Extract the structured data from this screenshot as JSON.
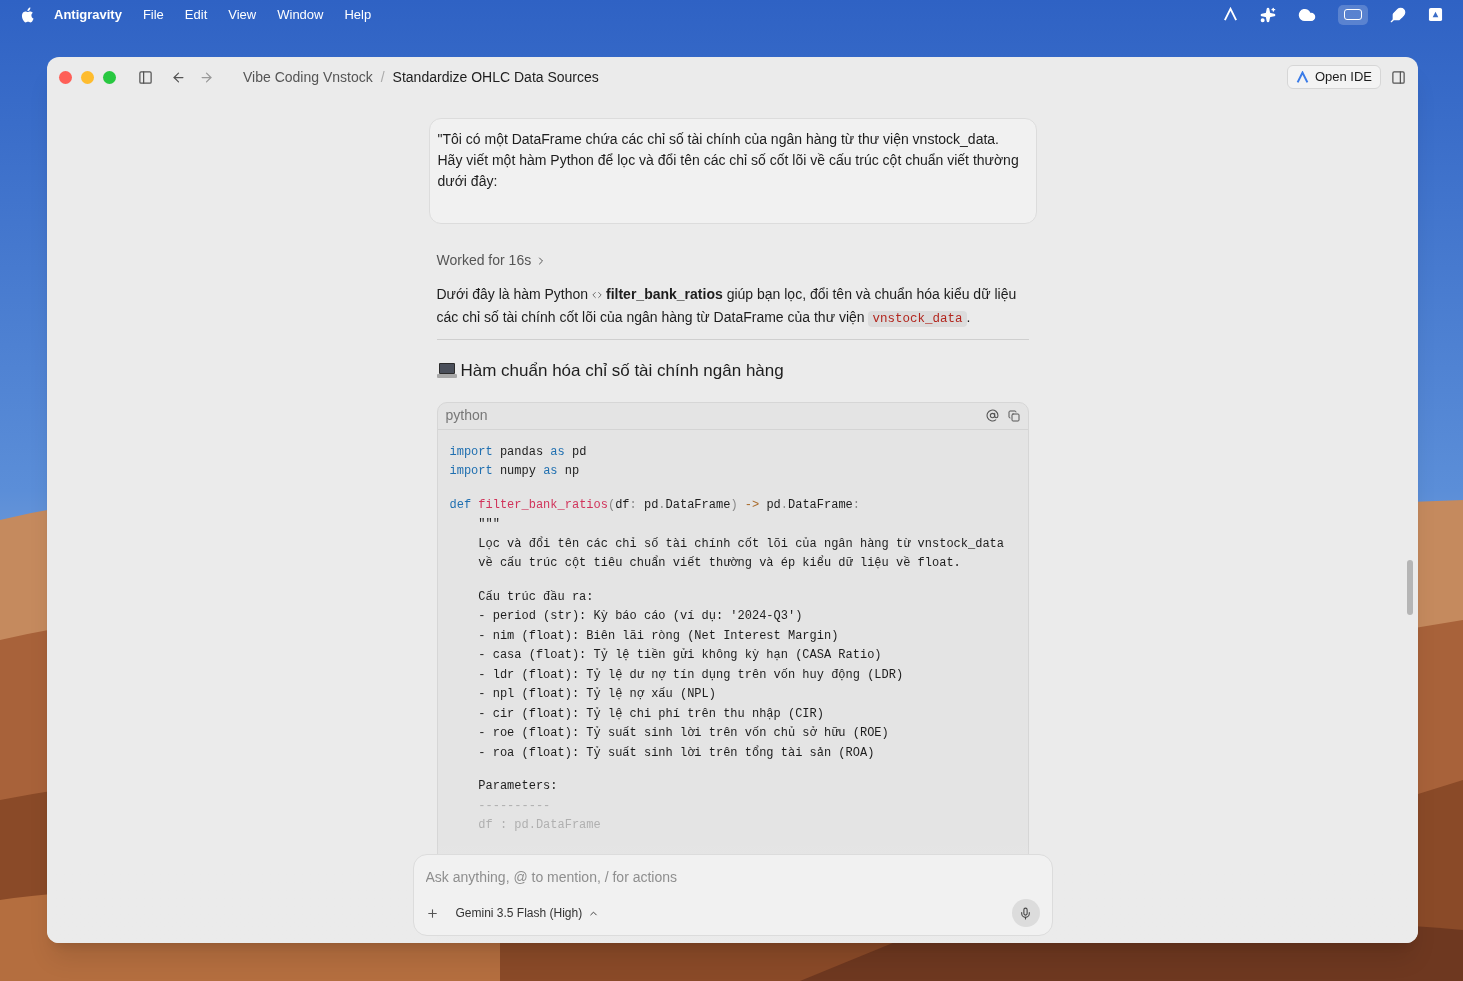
{
  "menu_bar": {
    "app_name": "Antigravity",
    "menus": [
      "File",
      "Edit",
      "View",
      "Window",
      "Help"
    ]
  },
  "window": {
    "breadcrumb": [
      "Vibe Coding Vnstock",
      "Standardize OHLC Data Sources"
    ],
    "breadcrumb_separator": "/",
    "open_ide_button": "Open IDE"
  },
  "user_message": "\"Tôi có một DataFrame chứa các chỉ số tài chính của ngân hàng từ thư viện vnstock_data. Hãy viết một hàm Python để lọc và đổi tên các chỉ số cốt lõi về cấu trúc cột chuẩn viết thường dưới đây:",
  "worked_for": {
    "label": "Worked for 16s",
    "expanded": false
  },
  "answer_intro": [
    {
      "kind": "text",
      "text": "Dưới đây là hàm Python"
    },
    {
      "kind": "symbol",
      "text": "filter_bank_ratios"
    },
    {
      "kind": "text",
      "text": "giúp bạn lọc, đổi tên và chuẩn hóa kiểu dữ liệu các chỉ số tài chính cốt lõi của ngân hàng từ DataFrame của thư viện"
    },
    {
      "kind": "code",
      "text": "vnstock_data"
    },
    {
      "kind": "text",
      "text": "."
    }
  ],
  "section_heading": "Hàm chuẩn hóa chỉ số tài chính ngân hàng",
  "code_block": {
    "language": "python",
    "lines": [
      [
        {
          "kind": "keyword",
          "text": "import"
        },
        {
          "kind": "plain",
          "text": " pandas "
        },
        {
          "kind": "keyword",
          "text": "as"
        },
        {
          "kind": "plain",
          "text": " pd"
        }
      ],
      [
        {
          "kind": "keyword",
          "text": "import"
        },
        {
          "kind": "plain",
          "text": " numpy "
        },
        {
          "kind": "keyword",
          "text": "as"
        },
        {
          "kind": "plain",
          "text": " np"
        }
      ],
      [
        {
          "kind": "blank"
        }
      ],
      [
        {
          "kind": "keyword",
          "text": "def"
        },
        {
          "kind": "function",
          "text": " filter_bank_ratios"
        },
        {
          "kind": "punct",
          "text": "("
        },
        {
          "kind": "plain",
          "text": "df"
        },
        {
          "kind": "punct",
          "text": ":"
        },
        {
          "kind": "plain",
          "text": " pd"
        },
        {
          "kind": "punct",
          "text": "."
        },
        {
          "kind": "plain",
          "text": "DataFrame"
        },
        {
          "kind": "punct",
          "text": ")"
        },
        {
          "kind": "operator",
          "text": " ->"
        },
        {
          "kind": "plain",
          "text": " pd"
        },
        {
          "kind": "punct",
          "text": "."
        },
        {
          "kind": "plain",
          "text": "DataFrame"
        },
        {
          "kind": "punct",
          "text": ":"
        }
      ],
      [
        {
          "kind": "plain",
          "text": "    \"\"\""
        }
      ],
      [
        {
          "kind": "plain",
          "text": "    Lọc và đổi tên các chỉ số tài chính cốt lõi của ngân hàng từ vnstock_data"
        }
      ],
      [
        {
          "kind": "plain",
          "text": "    về cấu trúc cột tiêu chuẩn viết thường và ép kiểu dữ liệu về float."
        }
      ],
      [
        {
          "kind": "blank"
        }
      ],
      [
        {
          "kind": "plain",
          "text": "    Cấu trúc đầu ra:"
        }
      ],
      [
        {
          "kind": "plain",
          "text": "    - period (str): Kỳ báo cáo (ví dụ: '2024-Q3')"
        }
      ],
      [
        {
          "kind": "plain",
          "text": "    - nim (float): Biên lãi ròng (Net Interest Margin)"
        }
      ],
      [
        {
          "kind": "plain",
          "text": "    - casa (float): Tỷ lệ tiền gửi không kỳ hạn (CASA Ratio)"
        }
      ],
      [
        {
          "kind": "plain",
          "text": "    - ldr (float): Tỷ lệ dư nợ tín dụng trên vốn huy động (LDR)"
        }
      ],
      [
        {
          "kind": "plain",
          "text": "    - npl (float): Tỷ lệ nợ xấu (NPL)"
        }
      ],
      [
        {
          "kind": "plain",
          "text": "    - cir (float): Tỷ lệ chi phí trên thu nhập (CIR)"
        }
      ],
      [
        {
          "kind": "plain",
          "text": "    - roe (float): Tỷ suất sinh lời trên vốn chủ sở hữu (ROE)"
        }
      ],
      [
        {
          "kind": "plain",
          "text": "    - roa (float): Tỷ suất sinh lời trên tổng tài sản (ROA)"
        }
      ],
      [
        {
          "kind": "blank"
        }
      ],
      [
        {
          "kind": "plain",
          "text": "    Parameters:"
        }
      ],
      [
        {
          "kind": "faded",
          "text": "    ----------"
        }
      ],
      [
        {
          "kind": "faded",
          "text": "    df : pd.DataFrame"
        }
      ]
    ]
  },
  "composer": {
    "placeholder": "Ask anything, @ to mention, / for actions",
    "model": "Gemini 3.5 Flash (High)"
  }
}
